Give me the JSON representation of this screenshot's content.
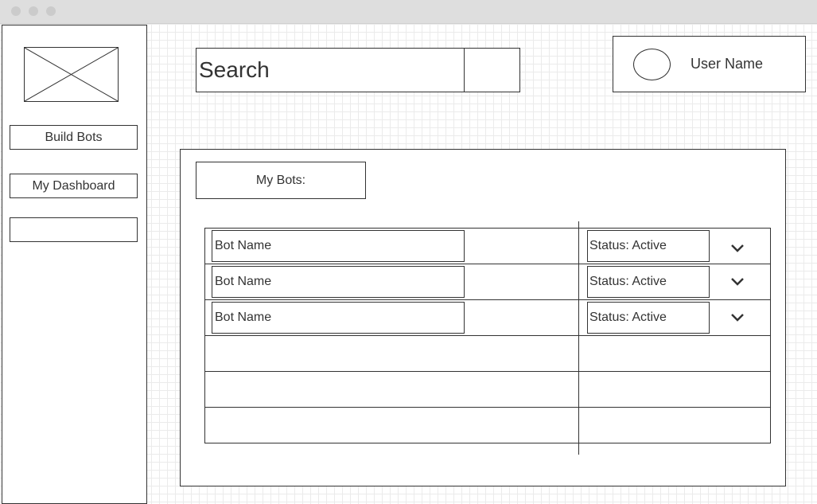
{
  "sidebar": {
    "items": [
      {
        "label": "Build Bots"
      },
      {
        "label": "My Dashboard"
      },
      {
        "label": ""
      }
    ]
  },
  "search": {
    "placeholder": "Search",
    "value": ""
  },
  "user": {
    "name": "User Name"
  },
  "main": {
    "heading": "My Bots:",
    "bots": [
      {
        "name": "Bot Name",
        "status": "Status: Active"
      },
      {
        "name": "Bot Name",
        "status": "Status: Active"
      },
      {
        "name": "Bot Name",
        "status": "Status: Active"
      }
    ]
  },
  "icons": {
    "logo": "image-placeholder-icon",
    "expand": "chevron-down-icon"
  },
  "colors": {
    "stroke": "#333333",
    "grid": "#ebebeb",
    "titlebar": "#dedede"
  }
}
